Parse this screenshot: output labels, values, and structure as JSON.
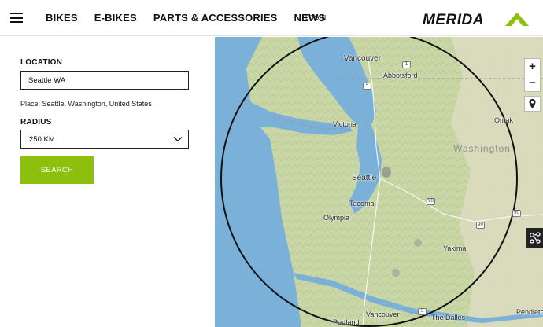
{
  "header": {
    "nav": [
      "BIKES",
      "E-BIKES",
      "PARTS & ACCESSORIES",
      "NEWS"
    ],
    "login_label": "LOGIN",
    "logo_text": "MERIDA"
  },
  "form": {
    "location_label": "LOCATION",
    "location_value": "Seattle WA",
    "place_text": "Place: Seattle, Washington, United States",
    "radius_label": "RADIUS",
    "radius_value": "250 KM",
    "search_label": "SEARCH"
  },
  "map": {
    "state_label": "Washington",
    "cities": [
      {
        "name": "Vancouver",
        "big": true
      },
      {
        "name": "Abbotsford",
        "big": false
      },
      {
        "name": "Victoria",
        "big": false
      },
      {
        "name": "Seattle",
        "big": true
      },
      {
        "name": "Tacoma",
        "big": false
      },
      {
        "name": "Olympia",
        "big": false
      },
      {
        "name": "Omak",
        "big": false
      },
      {
        "name": "Yakima",
        "big": false
      },
      {
        "name": "Vancouver",
        "big": false
      },
      {
        "name": "Portland",
        "big": false
      },
      {
        "name": "The Dalles",
        "big": false
      },
      {
        "name": "Pendleto",
        "big": false
      }
    ],
    "highway_shields": [
      "1",
      "5",
      "90",
      "90",
      "90",
      "5"
    ],
    "zoom_in": "+",
    "zoom_out": "−",
    "accent": "#8cc00d",
    "water_color": "#7bb0d8"
  }
}
